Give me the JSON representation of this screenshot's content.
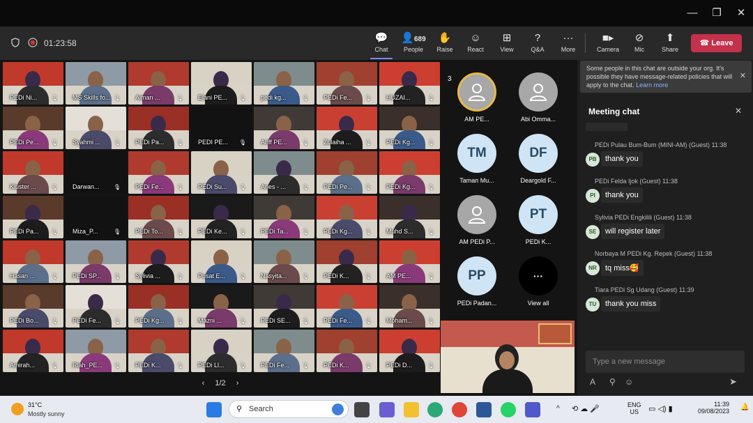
{
  "window": {
    "minimize": "—",
    "maximize": "❐",
    "close": "✕"
  },
  "meeting": {
    "timer": "01:23:58",
    "people_count": "689"
  },
  "toolbar": {
    "chat": "Chat",
    "people": "People",
    "raise": "Raise",
    "react": "React",
    "view": "View",
    "qa": "Q&A",
    "more": "More",
    "camera": "Camera",
    "mic": "Mic",
    "share": "Share",
    "leave": "Leave"
  },
  "tiles": [
    "PEDi Ni...",
    "MS Skills fo...",
    "Aiman ...",
    "Elani PE...",
    "pedi kg...",
    "PEDi Fe...",
    "HUZAI...",
    "PEDi Pe...",
    "Syahmi ...",
    "PEDi Pa...",
    "PEDI PE...",
    "Ariff PE...",
    "Zulaiha ...",
    "PEDi Kg...",
    "Kluster ...",
    "Darwan...",
    "PEDi Fe...",
    "PEDi Su...",
    "Anes - ...",
    "PEDi Pe...",
    "PEDi Kg...",
    "PEDi Pa...",
    "Miza_P...",
    "PEDi To...",
    "PEDi Ke...",
    "PEDi Ta...",
    "PEDi Kg...",
    "Muhd S...",
    "Hasan ...",
    "PEDi SP...",
    "Sylivia ...",
    "Pusat E...",
    "Nasyita...",
    "PEDi K...",
    "AM PE...",
    "PEDi Bo...",
    "PEDi Fe...",
    "PEDi Kg...",
    "Mazni ...",
    "PEDi SE...",
    "PEDi Fe...",
    "Moham...",
    "Amirah...",
    "Riah_PE...",
    "PEDi K...",
    "PEDi Ll...",
    "PEDi Fe...",
    "PEDi K...",
    "PEDi D..."
  ],
  "pager": {
    "label": "1/2",
    "prev": "‹",
    "next": "›"
  },
  "panel": [
    {
      "name": "AM PE...",
      "initials": "",
      "badge": "3"
    },
    {
      "name": "Abi Omma...",
      "initials": ""
    },
    {
      "name": "Taman Mu...",
      "initials": "TM"
    },
    {
      "name": "Deargold F...",
      "initials": "DF"
    },
    {
      "name": "AM PEDi P...",
      "initials": ""
    },
    {
      "name": "PEDi K...",
      "initials": "PT"
    },
    {
      "name": "PEDi Padan...",
      "initials": "PP"
    },
    {
      "name": "View all",
      "initials": "···"
    }
  ],
  "chat": {
    "notice": "Some people in this chat are outside your org. It's possible they have message-related policies that will apply to the chat.",
    "learn_more": "Learn more",
    "title": "Meeting chat",
    "messages": [
      {
        "sender": "PEDi Pulau Bum-Bum (MINI-AM) (Guest)",
        "time": "11:38",
        "initials": "PB",
        "text": "thank you"
      },
      {
        "sender": "PEDi Felda Ijok (Guest)",
        "time": "11:38",
        "initials": "PI",
        "text": "thank you"
      },
      {
        "sender": "Sylivia PEDi Engkilili (Guest)",
        "time": "11:38",
        "initials": "SE",
        "text": "will register later"
      },
      {
        "sender": "Norbaya M PEDi Kg. Repek (Guest)",
        "time": "11:38",
        "initials": "NR",
        "text": "tq miss🥰"
      },
      {
        "sender": "Tiara PEDi Sg Udang (Guest)",
        "time": "11:39",
        "initials": "TU",
        "text": "thank you miss"
      }
    ],
    "compose_placeholder": "Type a new message"
  },
  "taskbar": {
    "temp": "31°C",
    "weather": "Mostly sunny",
    "search": "Search",
    "lang1": "ENG",
    "lang2": "US",
    "time": "11:39",
    "date": "09/08/2023"
  }
}
